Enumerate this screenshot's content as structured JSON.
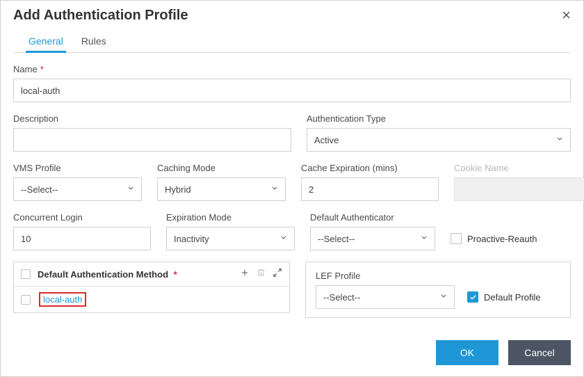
{
  "dialog": {
    "title": "Add Authentication Profile"
  },
  "tabs": {
    "general": "General",
    "rules": "Rules"
  },
  "labels": {
    "name": "Name",
    "description": "Description",
    "auth_type": "Authentication Type",
    "vms_profile": "VMS Profile",
    "caching_mode": "Caching Mode",
    "cache_exp": "Cache Expiration (mins)",
    "cookie_name": "Cookie Name",
    "concurrent_login": "Concurrent Login",
    "expiration_mode": "Expiration Mode",
    "default_authenticator": "Default Authenticator",
    "proactive": "Proactive-Reauth",
    "default_auth_method": "Default Authentication Method",
    "lef_profile": "LEF Profile",
    "default_profile": "Default Profile"
  },
  "values": {
    "name": "local-auth",
    "description": "",
    "auth_type": "Active",
    "vms_profile": "--Select--",
    "caching_mode": "Hybrid",
    "cache_exp": "2",
    "cookie_name": "",
    "concurrent_login": "10",
    "expiration_mode": "Inactivity",
    "default_authenticator": "--Select--",
    "lef_profile": "--Select--",
    "method_row": "local-auth"
  },
  "footer": {
    "ok": "OK",
    "cancel": "Cancel"
  }
}
